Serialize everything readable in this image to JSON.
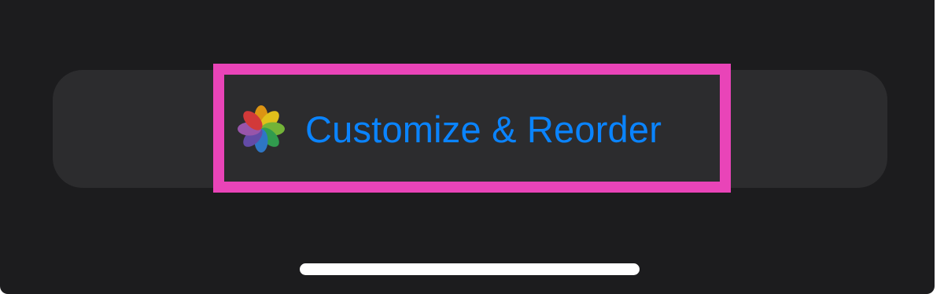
{
  "action_button": {
    "label": "Customize & Reorder",
    "icon": "photos-icon",
    "label_color": "#0a84ff"
  },
  "highlight_color": "#e944b8",
  "icon_petal_colors": [
    "#f0a011",
    "#f5d11a",
    "#7bc23a",
    "#32a852",
    "#2f7fd6",
    "#6a4fb5",
    "#a45ab8",
    "#e53b3b"
  ]
}
